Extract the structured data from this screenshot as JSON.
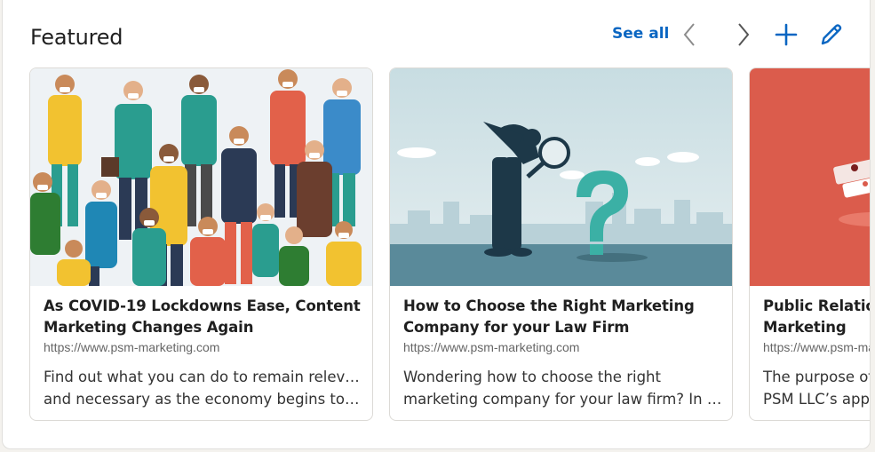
{
  "header": {
    "title": "Featured",
    "see_all_label": "See all",
    "icons": {
      "prev": "chevron-left-icon",
      "next": "chevron-right-icon",
      "add": "plus-icon",
      "edit": "pencil-icon"
    },
    "accent_color": "#0a66c2"
  },
  "cards": [
    {
      "title_line1": "As COVID-19 Lockdowns Ease, Content",
      "title_line2": "Marketing Changes Again",
      "url": "https://www.psm-marketing.com",
      "desc_line1": "Find out what you can do to remain relevant",
      "desc_line2": "and necessary as the economy begins to…",
      "thumbnail": "crowd-of-people-wearing-masks-illustration"
    },
    {
      "title_line1": "How to Choose the Right Marketing",
      "title_line2": "Company for your Law Firm",
      "url": "https://www.psm-marketing.com",
      "desc_line1": "Wondering how to choose the right",
      "desc_line2": "marketing company for your law firm? In thi…",
      "thumbnail": "man-with-magnifying-glass-question-mark-illustration"
    },
    {
      "title_line1": "Public Relations",
      "title_line2": "Marketing",
      "url": "https://www.psm-marketing.com",
      "desc_line1": "The purpose of",
      "desc_line2": "PSM LLC’s approach",
      "thumbnail": "red-background-illustration"
    }
  ]
}
